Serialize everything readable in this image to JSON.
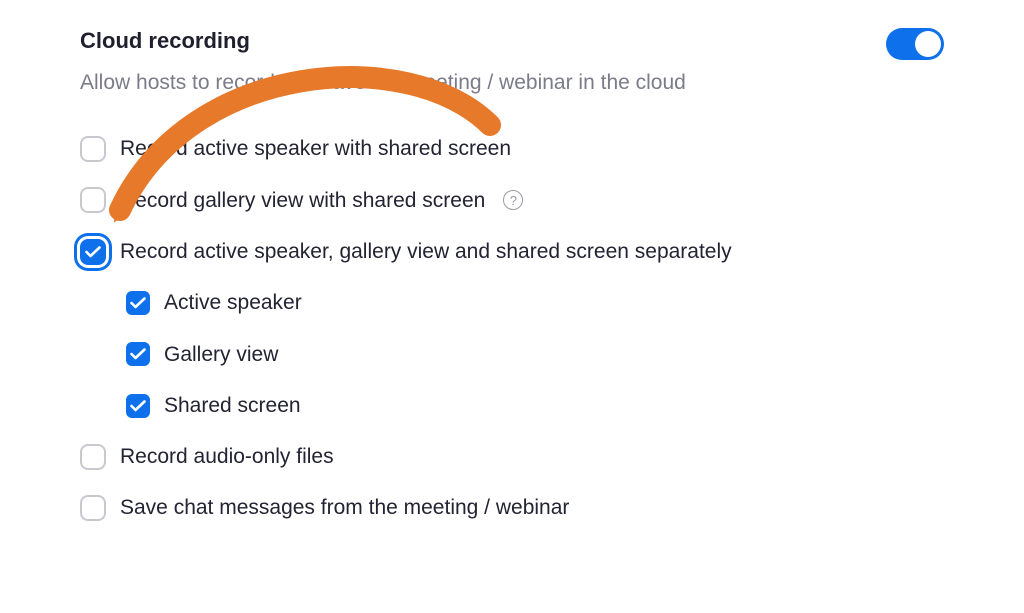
{
  "setting": {
    "title": "Cloud recording",
    "description": "Allow hosts to record and save the meeting / webinar in the cloud",
    "enabled": true
  },
  "options": {
    "record_active_speaker_shared": {
      "label": "Record active speaker with shared screen",
      "checked": false
    },
    "record_gallery_shared": {
      "label": "Record gallery view with shared screen",
      "checked": false,
      "help_tooltip": "?"
    },
    "record_separately": {
      "label": "Record active speaker, gallery view and shared screen separately",
      "checked": true,
      "sub": {
        "active_speaker": {
          "label": "Active speaker",
          "checked": true
        },
        "gallery_view": {
          "label": "Gallery view",
          "checked": true
        },
        "shared_screen": {
          "label": "Shared screen",
          "checked": true
        }
      }
    },
    "record_audio_only": {
      "label": "Record audio-only files",
      "checked": false
    },
    "save_chat": {
      "label": "Save chat messages from the meeting / webinar",
      "checked": false
    }
  },
  "annotation": {
    "arrow_color": "#e7792b"
  }
}
